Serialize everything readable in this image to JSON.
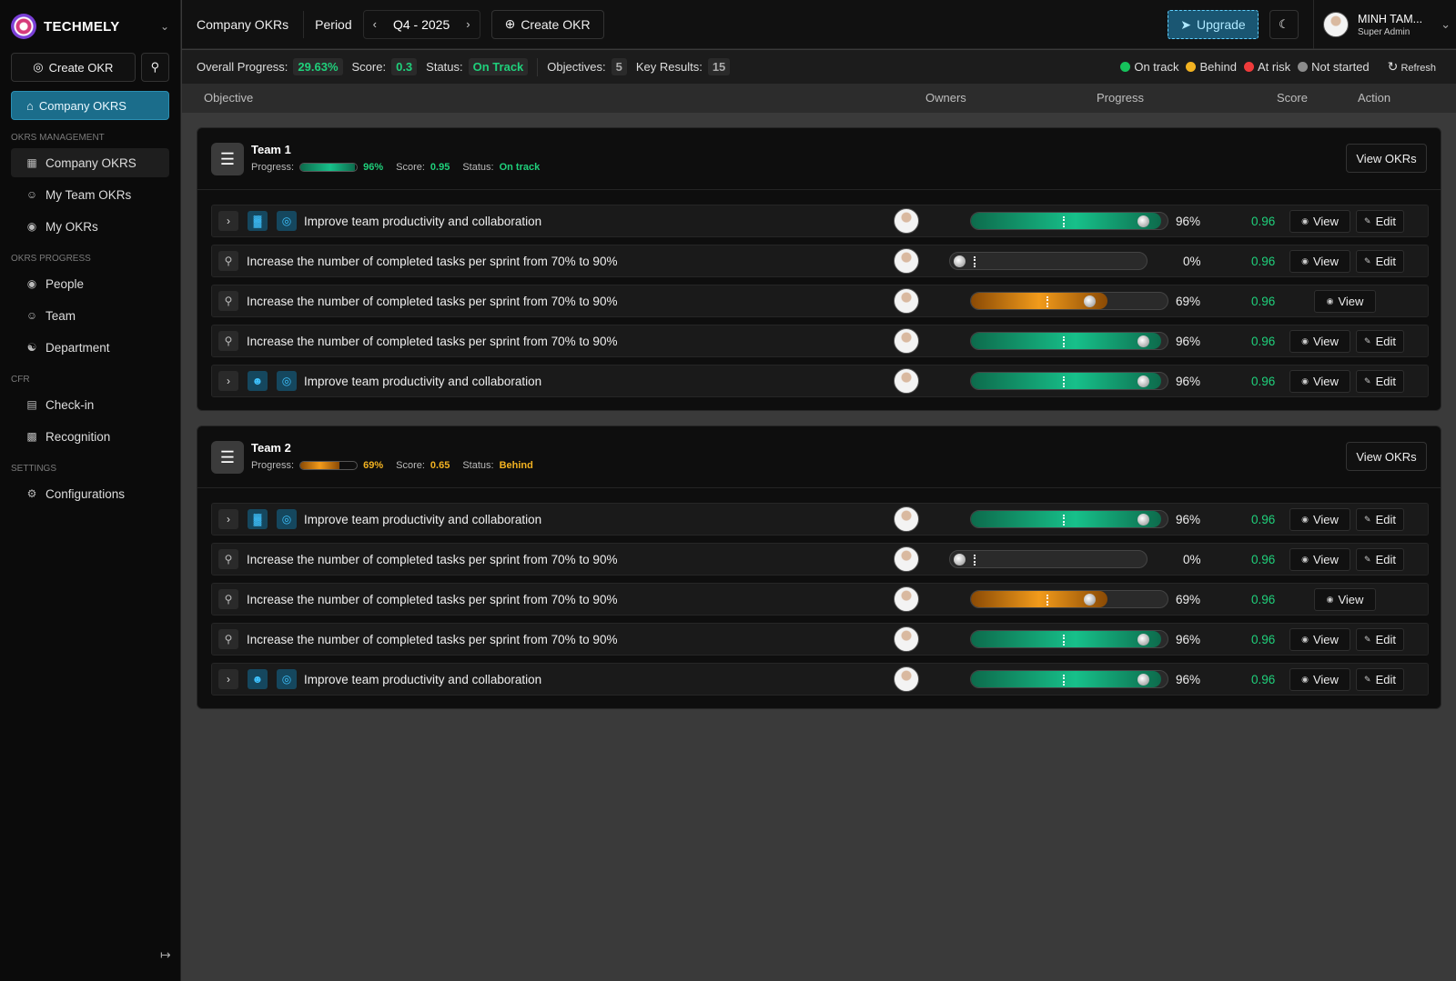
{
  "brand": {
    "name": "TECHMELY"
  },
  "sidebar": {
    "create_label": "Create OKR",
    "home_label": "Company OKRS",
    "sections": [
      {
        "title": "OKRS MANAGEMENT",
        "items": [
          {
            "label": "Company OKRS",
            "icon": "building-icon"
          },
          {
            "label": "My Team OKRs",
            "icon": "team-icon"
          },
          {
            "label": "My OKRs",
            "icon": "user-circle-icon"
          }
        ]
      },
      {
        "title": "OKRS PROGRESS",
        "items": [
          {
            "label": "People",
            "icon": "user-circle-icon"
          },
          {
            "label": "Team",
            "icon": "team-icon"
          },
          {
            "label": "Department",
            "icon": "department-icon"
          }
        ]
      },
      {
        "title": "CFR",
        "items": [
          {
            "label": "Check-in",
            "icon": "clipboard-icon"
          },
          {
            "label": "Recognition",
            "icon": "calendar-icon"
          }
        ]
      },
      {
        "title": "SETTINGS",
        "items": [
          {
            "label": "Configurations",
            "icon": "gear-icon"
          }
        ]
      }
    ]
  },
  "topbar": {
    "title": "Company OKRs",
    "period_label": "Period",
    "period_value": "Q4 - 2025",
    "create_label": "Create OKR",
    "upgrade_label": "Upgrade",
    "user_name": "MINH TAM...",
    "user_role": "Super Admin"
  },
  "stats": {
    "overall_label": "Overall Progress:",
    "overall_value": "29.63%",
    "score_label": "Score:",
    "score_value": "0.3",
    "status_label": "Status:",
    "status_value": "On Track",
    "objectives_label": "Objectives:",
    "objectives_value": "5",
    "kr_label": "Key Results:",
    "kr_value": "15",
    "legend": [
      {
        "label": "On track",
        "color": "#16c35c"
      },
      {
        "label": "Behind",
        "color": "#f2b221"
      },
      {
        "label": "At risk",
        "color": "#ef3b3b"
      },
      {
        "label": "Not started",
        "color": "#8c8c8c"
      }
    ],
    "refresh_label": "Refresh"
  },
  "table_headers": {
    "objective": "Objective",
    "owners": "Owners",
    "progress": "Progress",
    "score": "Score",
    "action": "Action"
  },
  "teams": [
    {
      "name": "Team 1",
      "progress_label": "Progress:",
      "progress": "96%",
      "progress_fraction": 0.96,
      "score_label": "Score:",
      "score": "0.95",
      "status_label": "Status:",
      "status": "On track",
      "status_kind": "green",
      "view_label": "View OKRs",
      "rows": [
        {
          "type": "objective",
          "icon": "bar-chart-icon",
          "text": "Improve team productivity and collaboration",
          "progress": 0.96,
          "pct": "96%",
          "score": "0.96",
          "color": "green",
          "view": "View",
          "edit": "Edit"
        },
        {
          "type": "kr",
          "text": "Increase the number of completed tasks per sprint from 70% to 90%",
          "progress": 0,
          "pct": "0%",
          "score": "0.96",
          "color": "none",
          "view": "View",
          "edit": "Edit"
        },
        {
          "type": "kr",
          "text": "Increase the number of completed tasks per sprint from 70% to 90%",
          "progress": 0.69,
          "pct": "69%",
          "score": "0.96",
          "color": "amber",
          "view": "View",
          "edit": ""
        },
        {
          "type": "kr",
          "text": "Increase the number of completed tasks per sprint from 70% to 90%",
          "progress": 0.96,
          "pct": "96%",
          "score": "0.96",
          "color": "green",
          "view": "View",
          "edit": "Edit"
        },
        {
          "type": "objective",
          "icon": "person-icon",
          "text": "Improve team productivity and collaboration",
          "progress": 0.96,
          "pct": "96%",
          "score": "0.96",
          "color": "green",
          "view": "View",
          "edit": "Edit"
        }
      ]
    },
    {
      "name": "Team 2",
      "progress_label": "Progress:",
      "progress": "69%",
      "progress_fraction": 0.69,
      "score_label": "Score:",
      "score": "0.65",
      "status_label": "Status:",
      "status": "Behind",
      "status_kind": "amber",
      "view_label": "View OKRs",
      "rows": [
        {
          "type": "objective",
          "icon": "bar-chart-icon",
          "text": "Improve team productivity and collaboration",
          "progress": 0.96,
          "pct": "96%",
          "score": "0.96",
          "color": "green",
          "view": "View",
          "edit": "Edit"
        },
        {
          "type": "kr",
          "text": "Increase the number of completed tasks per sprint from 70% to 90%",
          "progress": 0,
          "pct": "0%",
          "score": "0.96",
          "color": "none",
          "view": "View",
          "edit": "Edit"
        },
        {
          "type": "kr",
          "text": "Increase the number of completed tasks per sprint from 70% to 90%",
          "progress": 0.69,
          "pct": "69%",
          "score": "0.96",
          "color": "amber",
          "view": "View",
          "edit": ""
        },
        {
          "type": "kr",
          "text": "Increase the number of completed tasks per sprint from 70% to 90%",
          "progress": 0.96,
          "pct": "96%",
          "score": "0.96",
          "color": "green",
          "view": "View",
          "edit": "Edit"
        },
        {
          "type": "objective",
          "icon": "person-icon",
          "text": "Improve team productivity and collaboration",
          "progress": 0.96,
          "pct": "96%",
          "score": "0.96",
          "color": "green",
          "view": "View",
          "edit": "Edit"
        }
      ]
    }
  ]
}
